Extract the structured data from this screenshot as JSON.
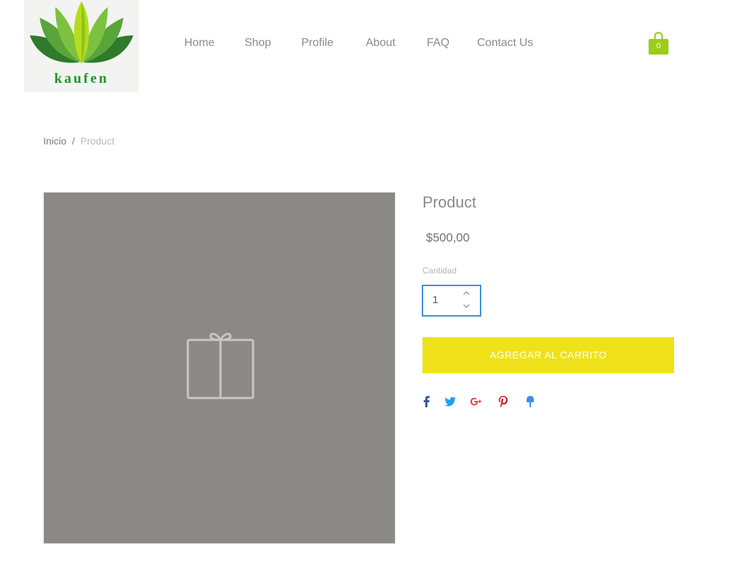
{
  "logo": {
    "text": "kaufen"
  },
  "nav": {
    "items": [
      "Home",
      "Shop",
      "Profile",
      "About",
      "FAQ",
      "Contact Us"
    ]
  },
  "cart": {
    "count": "0",
    "color": "#9ccc1c"
  },
  "breadcrumb": {
    "home": "Inicio",
    "separator": "/",
    "current": "Product"
  },
  "product": {
    "title": "Product",
    "price": "$500,00",
    "quantity_label": "Cantidad",
    "quantity": "1",
    "add_to_cart": "AGREGAR AL CARRITO",
    "image_bg": "#8b8987"
  },
  "share": {
    "icons": [
      "facebook-icon",
      "twitter-icon",
      "google-plus-icon",
      "pinterest-icon",
      "fancy-icon"
    ],
    "colors": [
      "#3b5998",
      "#1da1f2",
      "#dd4b39",
      "#cb2027",
      "#3d8eea"
    ]
  },
  "colors": {
    "accent_button": "#efe21b",
    "focus_border": "#3b8ed8"
  }
}
